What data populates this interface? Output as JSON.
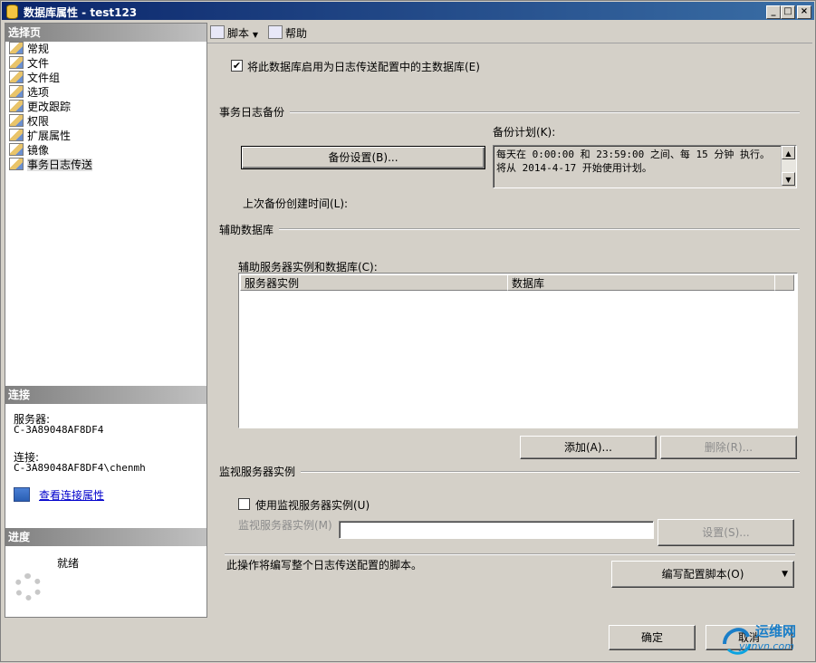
{
  "window": {
    "title": "数据库属性 - test123",
    "min": "_",
    "max": "□",
    "close": "×"
  },
  "left": {
    "select_header": "选择页",
    "pages": [
      {
        "label": "常规"
      },
      {
        "label": "文件"
      },
      {
        "label": "文件组"
      },
      {
        "label": "选项"
      },
      {
        "label": "更改跟踪"
      },
      {
        "label": "权限"
      },
      {
        "label": "扩展属性"
      },
      {
        "label": "镜像"
      },
      {
        "label": "事务日志传送"
      }
    ],
    "connection_header": "连接",
    "server_label": "服务器:",
    "server_value": "C-3A89048AF8DF4",
    "conn_label": "连接:",
    "conn_value": "C-3A89048AF8DF4\\chenmh",
    "view_conn_link": "查看连接属性",
    "progress_header": "进度",
    "progress_status": "就绪"
  },
  "toolbar": {
    "script": "脚本",
    "help": "帮助"
  },
  "main": {
    "enable_primary": "将此数据库启用为日志传送配置中的主数据库(E)",
    "enable_primary_checked": true,
    "tlog_group": "事务日志备份",
    "schedule_label": "备份计划(K):",
    "schedule_text": "每天在 0:00:00 和 23:59:00 之间、每 15 分钟 执行。将从 2014-4-17 开始使用计划。",
    "backup_settings_btn": "备份设置(B)...",
    "last_backup_label": "上次备份创建时间(L):",
    "secondary_group": "辅助数据库",
    "secondary_label": "辅助服务器实例和数据库(C):",
    "grid_cols": [
      "服务器实例",
      "数据库"
    ],
    "add_btn": "添加(A)...",
    "remove_btn": "删除(R)...",
    "monitor_group": "监视服务器实例",
    "use_monitor": "使用监视服务器实例(U)",
    "monitor_instance_label": "监视服务器实例(M)",
    "monitor_instance_value": "",
    "settings_btn": "设置(S)...",
    "script_note": "此操作将编写整个日志传送配置的脚本。",
    "script_config_btn": "编写配置脚本(O)"
  },
  "footer": {
    "ok": "确定",
    "cancel": "取消"
  },
  "watermark": {
    "cn": "运维网",
    "en": "yunvn.com"
  }
}
